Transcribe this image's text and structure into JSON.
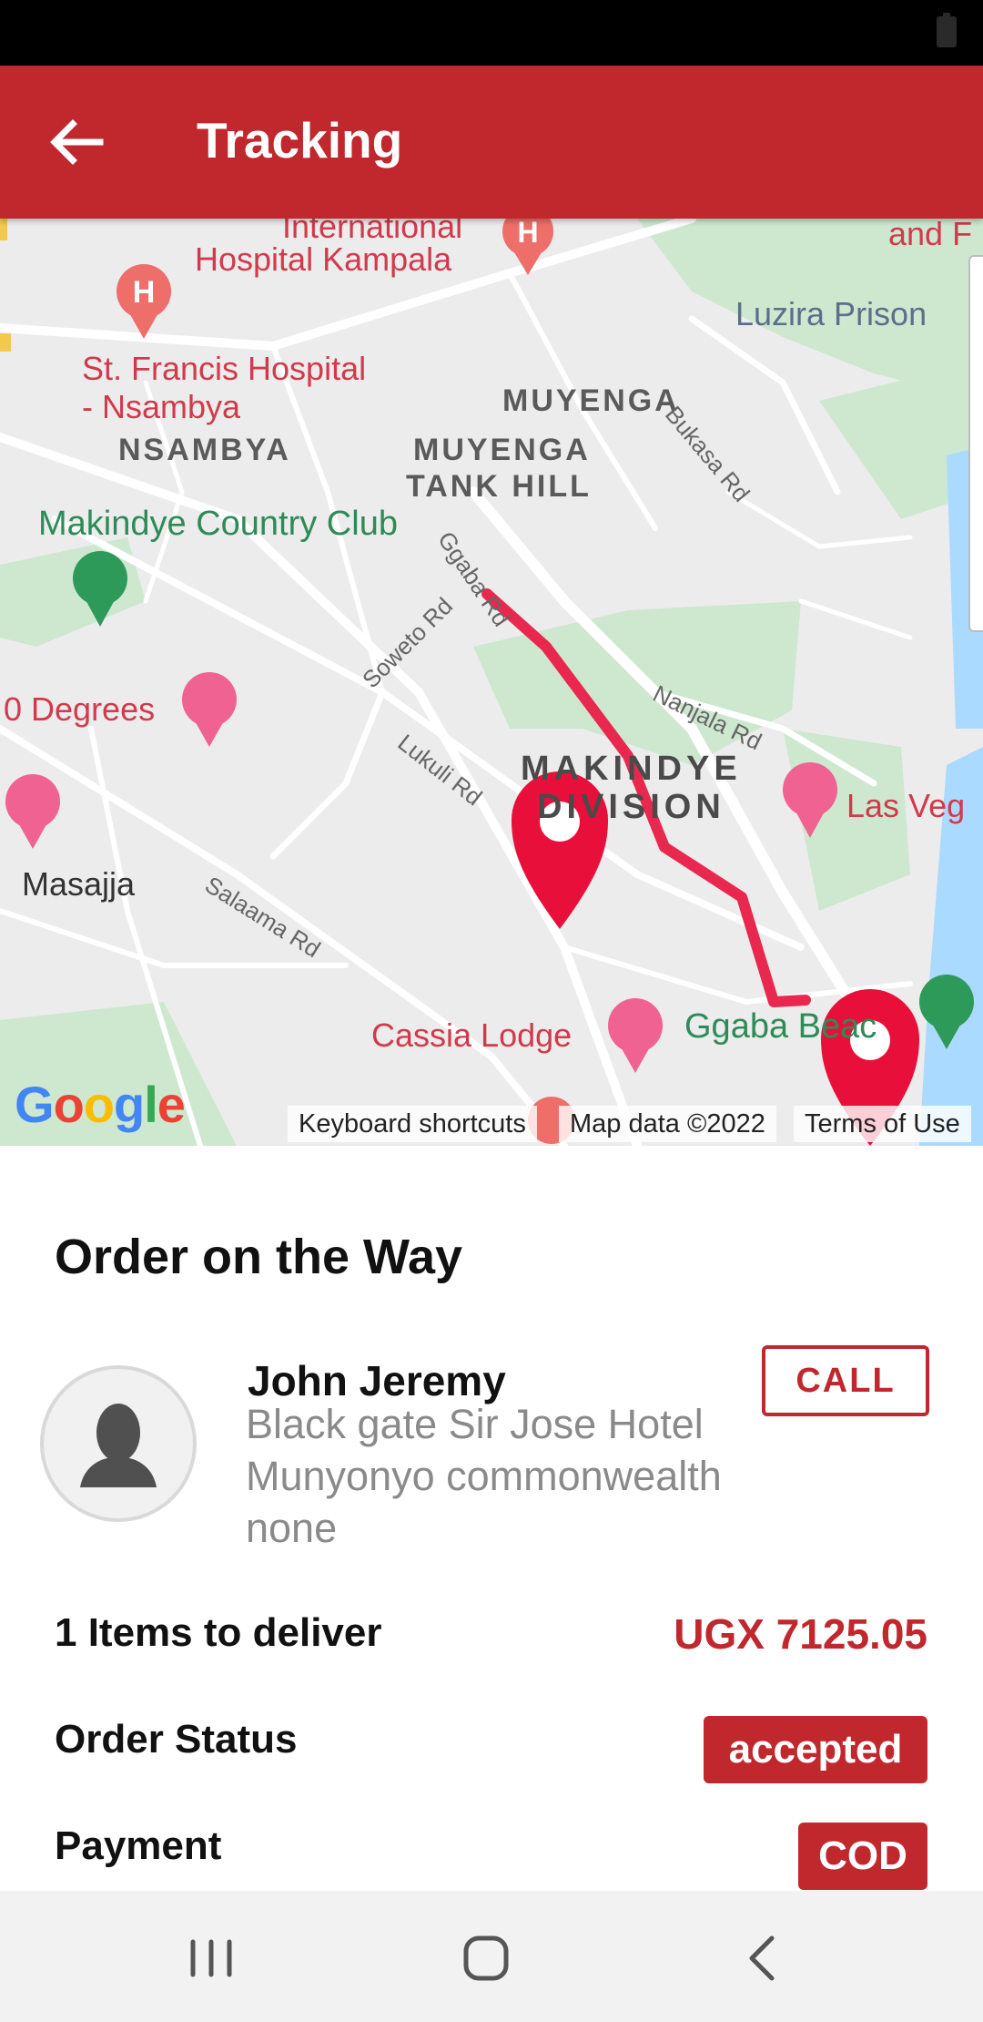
{
  "app_bar": {
    "title": "Tracking"
  },
  "map": {
    "labels": {
      "international_hospital": "International",
      "hospital_kampala": "Hospital Kampala",
      "and_f": "and F",
      "luzira_prison": "Luzira Prison",
      "st_francis_1": "St. Francis Hospital",
      "st_francis_2": "- Nsambya",
      "nsambya": "NSAMBYA",
      "muyenga": "MUYENGA",
      "muyenga_tank_hill_1": "MUYENGA",
      "muyenga_tank_hill_2": "TANK HILL",
      "bukasa_rd": "Bukasa Rd",
      "makindye_country_club": "Makindye Country Club",
      "ggaba_rd": "Ggaba Rd",
      "soweto_rd": "Soweto Rd",
      "zero_degrees": "0 Degrees",
      "nanjala_rd": "Nanjala Rd",
      "makindye_division_1": "MAKINDYE",
      "makindye_division_2": "DIVISION",
      "lukuli_rd": "Lukuli Rd",
      "las_vegas": "Las Veg",
      "masajja": "Masajja",
      "salaama_rd": "Salaama Rd",
      "cassia_lodge": "Cassia Lodge",
      "ggaba_beach": "Ggaba Beac"
    },
    "google_logo": "Google",
    "attribution": {
      "keyboard_shortcuts": "Keyboard shortcuts",
      "map_data": "Map data ©2022",
      "terms": "Terms of Use"
    },
    "colors": {
      "route": "#e8284e",
      "pin": "#e8103a",
      "water": "#aadaff",
      "park": "#c8e6c9"
    }
  },
  "order": {
    "heading": "Order on the Way",
    "customer": {
      "name": "John Jeremy",
      "address_lines": [
        "Black gate Sir Jose Hotel",
        "Munyonyo commonwealth",
        "none"
      ]
    },
    "call_label": "CALL",
    "items_label": "1 Items to deliver",
    "price": "UGX 7125.05",
    "status_label": "Order Status",
    "status_value": "accepted",
    "payment_label": "Payment",
    "payment_value": "COD"
  },
  "colors": {
    "primary": "#c0282e"
  }
}
